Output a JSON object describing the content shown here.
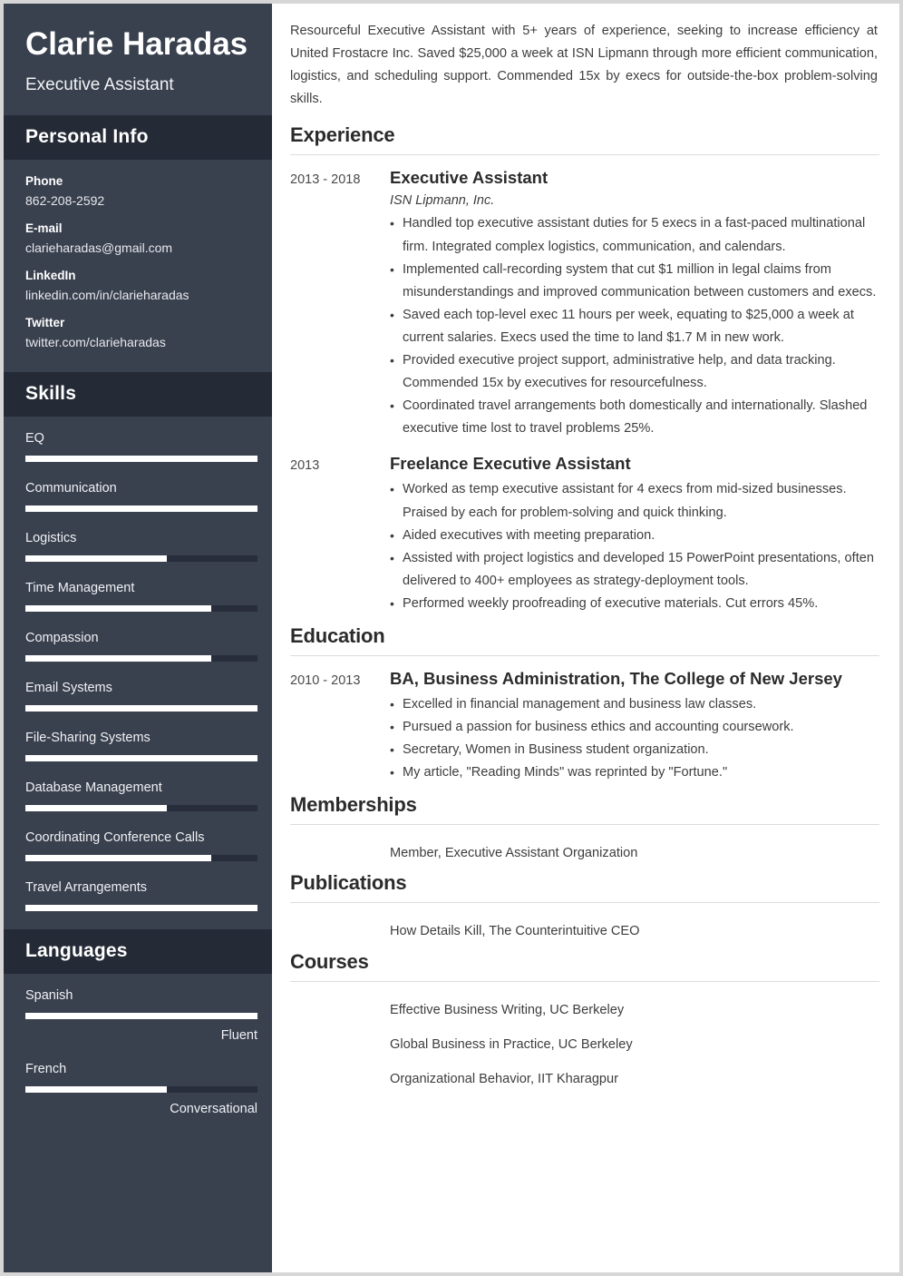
{
  "sidebar": {
    "name": "Clarie Haradas",
    "job_title": "Executive Assistant",
    "personal_info": {
      "heading": "Personal Info",
      "items": [
        {
          "label": "Phone",
          "value": "862-208-2592"
        },
        {
          "label": "E-mail",
          "value": "clarieharadas@gmail.com"
        },
        {
          "label": "LinkedIn",
          "value": "linkedin.com/in/clarieharadas"
        },
        {
          "label": "Twitter",
          "value": "twitter.com/clarieharadas"
        }
      ]
    },
    "skills": {
      "heading": "Skills",
      "items": [
        {
          "label": "EQ",
          "level": 100
        },
        {
          "label": "Communication",
          "level": 100
        },
        {
          "label": "Logistics",
          "level": 61
        },
        {
          "label": "Time Management",
          "level": 80
        },
        {
          "label": "Compassion",
          "level": 80
        },
        {
          "label": "Email Systems",
          "level": 100
        },
        {
          "label": "File-Sharing Systems",
          "level": 100
        },
        {
          "label": "Database Management",
          "level": 61
        },
        {
          "label": "Coordinating Conference Calls",
          "level": 80
        },
        {
          "label": "Travel Arrangements",
          "level": 100
        }
      ]
    },
    "languages": {
      "heading": "Languages",
      "items": [
        {
          "label": "Spanish",
          "level": 100,
          "proficiency": "Fluent"
        },
        {
          "label": "French",
          "level": 61,
          "proficiency": "Conversational"
        }
      ]
    }
  },
  "main": {
    "summary": "Resourceful Executive Assistant with 5+ years of experience, seeking to increase efficiency at United Frostacre Inc. Saved $25,000 a week at ISN Lipmann through more efficient communication, logistics, and scheduling support. Commended 15x by execs for outside-the-box problem-solving skills.",
    "experience": {
      "heading": "Experience",
      "entries": [
        {
          "date": "2013 - 2018",
          "title": "Executive Assistant",
          "subtitle": "ISN Lipmann, Inc.",
          "bullets": [
            "Handled top executive assistant duties for 5 execs in a fast-paced multinational firm. Integrated complex logistics, communication, and calendars.",
            "Implemented call-recording system that cut $1 million in legal claims from misunderstandings and improved communication between customers and execs.",
            "Saved each top-level exec 11 hours per week, equating to $25,000 a week at current salaries. Execs used the time to land $1.7 M in new work.",
            "Provided executive project support, administrative help, and data tracking. Commended 15x by executives for resourcefulness.",
            "Coordinated travel arrangements both domestically and internationally. Slashed executive time lost to travel problems 25%."
          ]
        },
        {
          "date": "2013",
          "title": "Freelance Executive Assistant",
          "subtitle": "",
          "bullets": [
            "Worked as temp executive assistant for 4 execs from mid-sized businesses. Praised by each for problem-solving and quick thinking.",
            "Aided executives with meeting preparation.",
            "Assisted with project logistics and developed 15 PowerPoint presentations, often delivered to 400+ employees as strategy-deployment tools.",
            "Performed weekly proofreading of executive materials. Cut errors 45%."
          ]
        }
      ]
    },
    "education": {
      "heading": "Education",
      "entries": [
        {
          "date": "2010 - 2013",
          "title": "BA, Business Administration, The College of New Jersey",
          "subtitle": "",
          "bullets": [
            "Excelled in financial management and business law classes.",
            "Pursued a passion for business ethics and accounting coursework.",
            "Secretary, Women in Business student organization.",
            "My article, \"Reading Minds\" was reprinted by \"Fortune.\""
          ]
        }
      ]
    },
    "memberships": {
      "heading": "Memberships",
      "entries": [
        {
          "date": "",
          "text": "Member, Executive Assistant Organization"
        }
      ]
    },
    "publications": {
      "heading": "Publications",
      "entries": [
        {
          "date": "",
          "text": "How Details Kill, The Counterintuitive CEO"
        }
      ]
    },
    "courses": {
      "heading": "Courses",
      "entries": [
        {
          "date": "",
          "text": "Effective Business Writing, UC Berkeley"
        },
        {
          "date": "",
          "text": "Global Business in Practice, UC Berkeley"
        },
        {
          "date": "",
          "text": "Organizational Behavior, IIT Kharagpur"
        }
      ]
    }
  }
}
